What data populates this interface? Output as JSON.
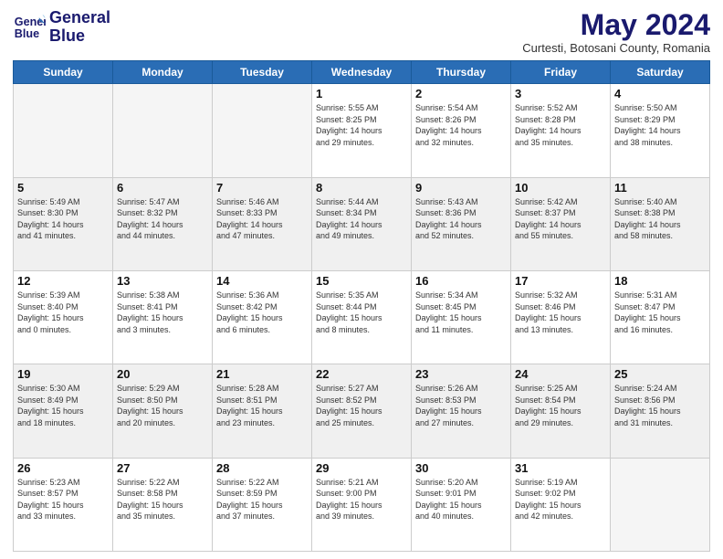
{
  "logo": {
    "line1": "General",
    "line2": "Blue"
  },
  "title": "May 2024",
  "subtitle": "Curtesti, Botosani County, Romania",
  "days_header": [
    "Sunday",
    "Monday",
    "Tuesday",
    "Wednesday",
    "Thursday",
    "Friday",
    "Saturday"
  ],
  "weeks": [
    [
      {
        "day": "",
        "info": ""
      },
      {
        "day": "",
        "info": ""
      },
      {
        "day": "",
        "info": ""
      },
      {
        "day": "1",
        "info": "Sunrise: 5:55 AM\nSunset: 8:25 PM\nDaylight: 14 hours\nand 29 minutes."
      },
      {
        "day": "2",
        "info": "Sunrise: 5:54 AM\nSunset: 8:26 PM\nDaylight: 14 hours\nand 32 minutes."
      },
      {
        "day": "3",
        "info": "Sunrise: 5:52 AM\nSunset: 8:28 PM\nDaylight: 14 hours\nand 35 minutes."
      },
      {
        "day": "4",
        "info": "Sunrise: 5:50 AM\nSunset: 8:29 PM\nDaylight: 14 hours\nand 38 minutes."
      }
    ],
    [
      {
        "day": "5",
        "info": "Sunrise: 5:49 AM\nSunset: 8:30 PM\nDaylight: 14 hours\nand 41 minutes."
      },
      {
        "day": "6",
        "info": "Sunrise: 5:47 AM\nSunset: 8:32 PM\nDaylight: 14 hours\nand 44 minutes."
      },
      {
        "day": "7",
        "info": "Sunrise: 5:46 AM\nSunset: 8:33 PM\nDaylight: 14 hours\nand 47 minutes."
      },
      {
        "day": "8",
        "info": "Sunrise: 5:44 AM\nSunset: 8:34 PM\nDaylight: 14 hours\nand 49 minutes."
      },
      {
        "day": "9",
        "info": "Sunrise: 5:43 AM\nSunset: 8:36 PM\nDaylight: 14 hours\nand 52 minutes."
      },
      {
        "day": "10",
        "info": "Sunrise: 5:42 AM\nSunset: 8:37 PM\nDaylight: 14 hours\nand 55 minutes."
      },
      {
        "day": "11",
        "info": "Sunrise: 5:40 AM\nSunset: 8:38 PM\nDaylight: 14 hours\nand 58 minutes."
      }
    ],
    [
      {
        "day": "12",
        "info": "Sunrise: 5:39 AM\nSunset: 8:40 PM\nDaylight: 15 hours\nand 0 minutes."
      },
      {
        "day": "13",
        "info": "Sunrise: 5:38 AM\nSunset: 8:41 PM\nDaylight: 15 hours\nand 3 minutes."
      },
      {
        "day": "14",
        "info": "Sunrise: 5:36 AM\nSunset: 8:42 PM\nDaylight: 15 hours\nand 6 minutes."
      },
      {
        "day": "15",
        "info": "Sunrise: 5:35 AM\nSunset: 8:44 PM\nDaylight: 15 hours\nand 8 minutes."
      },
      {
        "day": "16",
        "info": "Sunrise: 5:34 AM\nSunset: 8:45 PM\nDaylight: 15 hours\nand 11 minutes."
      },
      {
        "day": "17",
        "info": "Sunrise: 5:32 AM\nSunset: 8:46 PM\nDaylight: 15 hours\nand 13 minutes."
      },
      {
        "day": "18",
        "info": "Sunrise: 5:31 AM\nSunset: 8:47 PM\nDaylight: 15 hours\nand 16 minutes."
      }
    ],
    [
      {
        "day": "19",
        "info": "Sunrise: 5:30 AM\nSunset: 8:49 PM\nDaylight: 15 hours\nand 18 minutes."
      },
      {
        "day": "20",
        "info": "Sunrise: 5:29 AM\nSunset: 8:50 PM\nDaylight: 15 hours\nand 20 minutes."
      },
      {
        "day": "21",
        "info": "Sunrise: 5:28 AM\nSunset: 8:51 PM\nDaylight: 15 hours\nand 23 minutes."
      },
      {
        "day": "22",
        "info": "Sunrise: 5:27 AM\nSunset: 8:52 PM\nDaylight: 15 hours\nand 25 minutes."
      },
      {
        "day": "23",
        "info": "Sunrise: 5:26 AM\nSunset: 8:53 PM\nDaylight: 15 hours\nand 27 minutes."
      },
      {
        "day": "24",
        "info": "Sunrise: 5:25 AM\nSunset: 8:54 PM\nDaylight: 15 hours\nand 29 minutes."
      },
      {
        "day": "25",
        "info": "Sunrise: 5:24 AM\nSunset: 8:56 PM\nDaylight: 15 hours\nand 31 minutes."
      }
    ],
    [
      {
        "day": "26",
        "info": "Sunrise: 5:23 AM\nSunset: 8:57 PM\nDaylight: 15 hours\nand 33 minutes."
      },
      {
        "day": "27",
        "info": "Sunrise: 5:22 AM\nSunset: 8:58 PM\nDaylight: 15 hours\nand 35 minutes."
      },
      {
        "day": "28",
        "info": "Sunrise: 5:22 AM\nSunset: 8:59 PM\nDaylight: 15 hours\nand 37 minutes."
      },
      {
        "day": "29",
        "info": "Sunrise: 5:21 AM\nSunset: 9:00 PM\nDaylight: 15 hours\nand 39 minutes."
      },
      {
        "day": "30",
        "info": "Sunrise: 5:20 AM\nSunset: 9:01 PM\nDaylight: 15 hours\nand 40 minutes."
      },
      {
        "day": "31",
        "info": "Sunrise: 5:19 AM\nSunset: 9:02 PM\nDaylight: 15 hours\nand 42 minutes."
      },
      {
        "day": "",
        "info": ""
      }
    ]
  ],
  "colors": {
    "header_bg": "#2a6db5",
    "title_color": "#1a1a6e",
    "shaded_row": "#f0f0f0"
  }
}
